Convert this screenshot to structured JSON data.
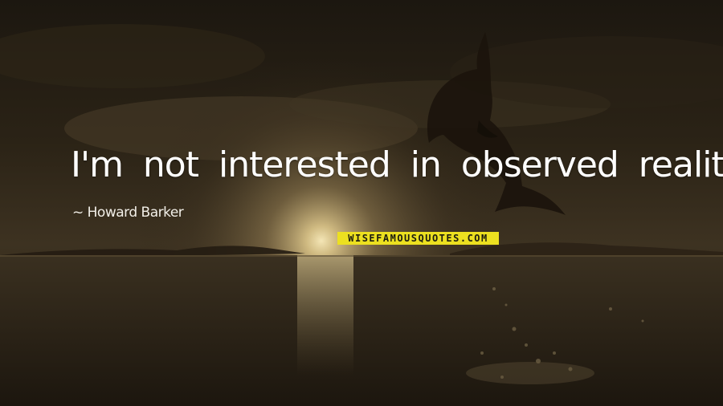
{
  "quote": {
    "text": "I'm not interested in observed reality.",
    "author": "~ Howard Barker"
  },
  "brand": {
    "label": "WISEFAMOUSQUOTES.COM",
    "color": "#ece020"
  },
  "scene": {
    "sky_color": "#2b2316",
    "sea_color": "#2a2217",
    "sun_glow": "#f4e6b6",
    "silhouette_color": "#1b130c"
  }
}
